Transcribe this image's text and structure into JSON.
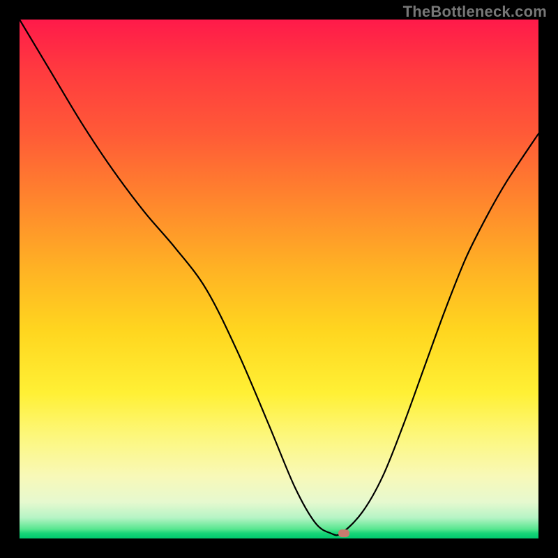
{
  "watermark": "TheBottleneck.com",
  "colors": {
    "frame": "#000000",
    "curve": "#000000",
    "marker": "#c97b6f",
    "gradient_top": "#ff1a4a",
    "gradient_bottom": "#00c96e"
  },
  "chart_data": {
    "type": "line",
    "title": "",
    "xlabel": "",
    "ylabel": "",
    "xlim": [
      0,
      100
    ],
    "ylim": [
      0,
      100
    ],
    "grid": false,
    "legend": false,
    "series": [
      {
        "name": "curve",
        "x": [
          0,
          6,
          12,
          18,
          24,
          30,
          36,
          42,
          48,
          53,
          57,
          60,
          62,
          66,
          70,
          74,
          78,
          82,
          86,
          90,
          94,
          100
        ],
        "y": [
          100,
          90,
          80,
          71,
          63,
          56,
          48,
          36,
          22,
          10,
          3,
          1,
          1,
          5,
          12,
          22,
          33,
          44,
          54,
          62,
          69,
          78
        ]
      }
    ],
    "flat_segment": {
      "x_start": 57,
      "x_end": 62,
      "y": 1
    },
    "marker": {
      "x": 62.5,
      "y": 1
    },
    "annotations": []
  }
}
